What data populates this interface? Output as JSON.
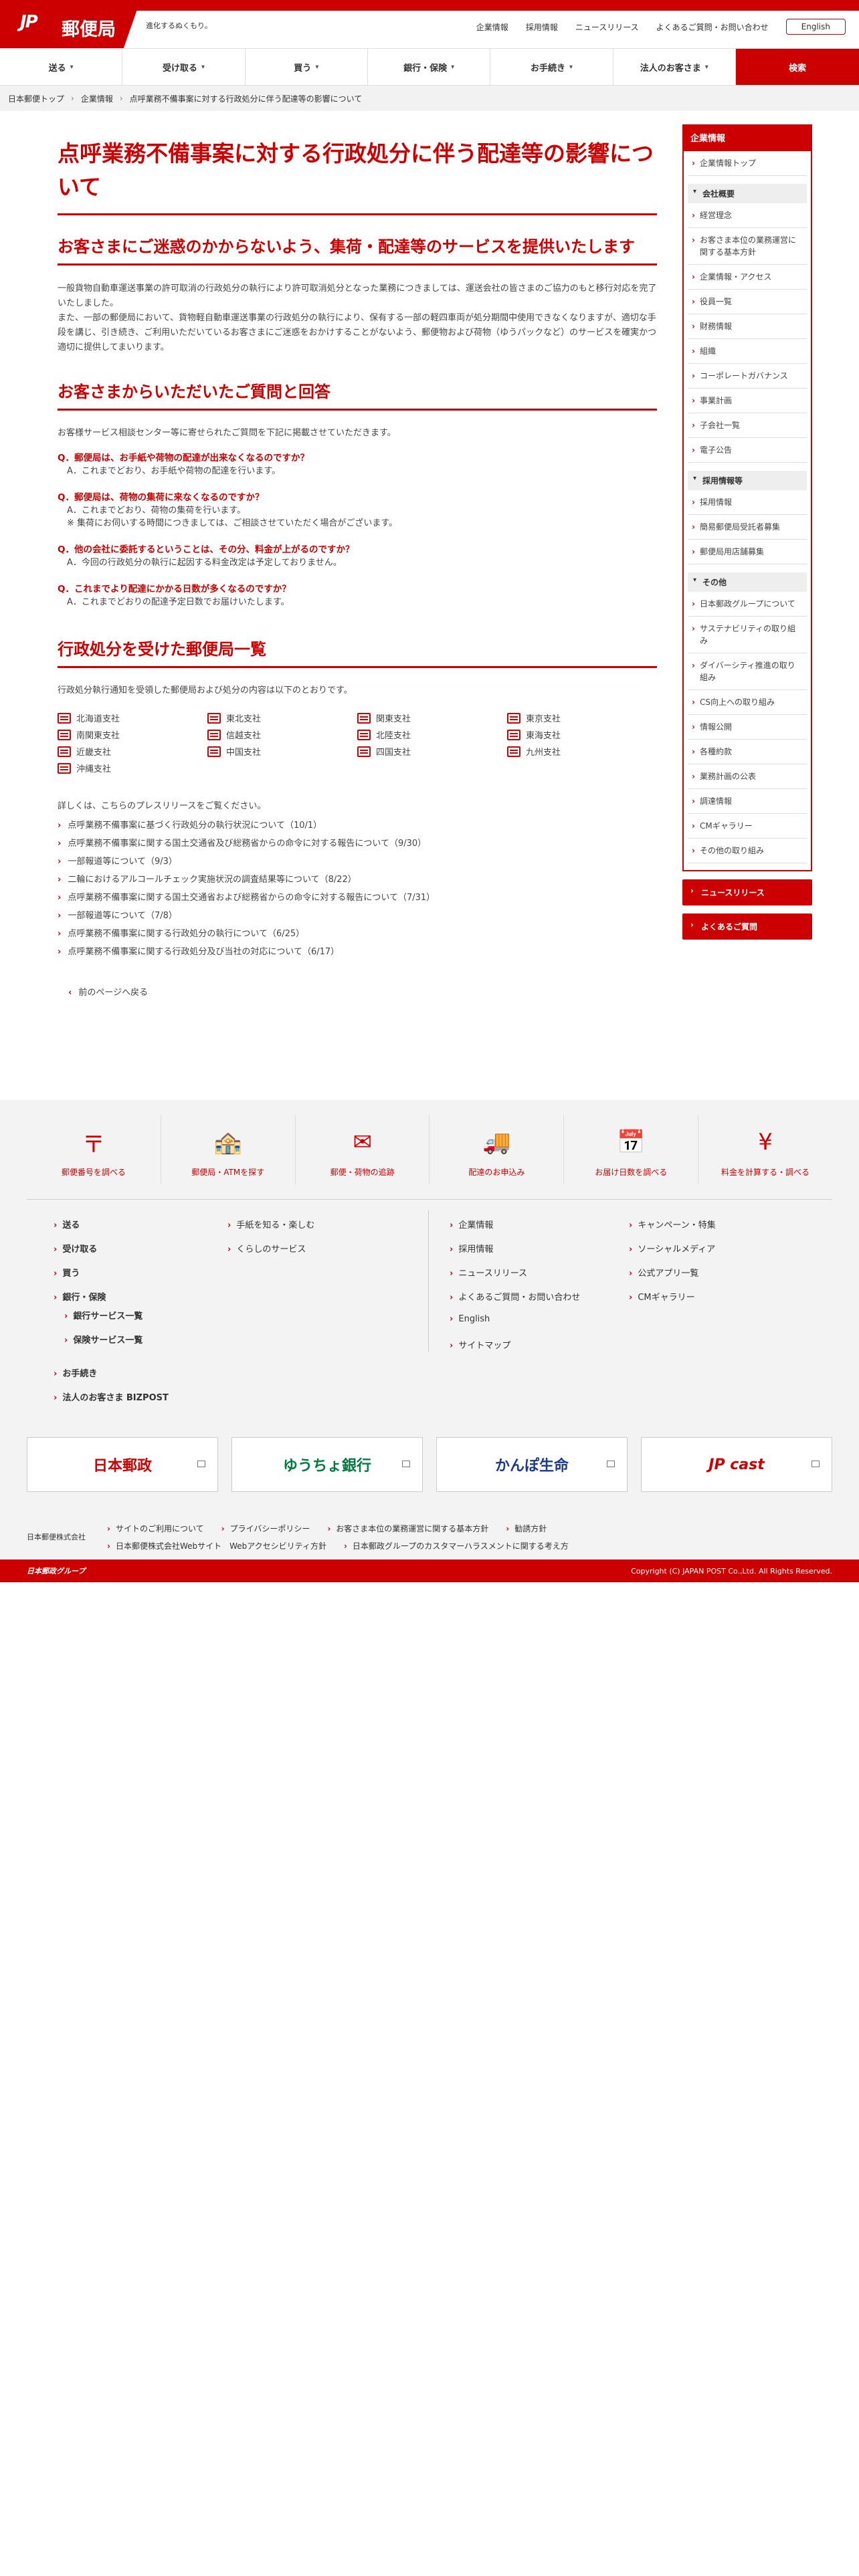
{
  "header": {
    "logo_mark": "JP",
    "logo_text": "郵便局",
    "tagline": "進化するぬくもり。",
    "links": [
      "企業情報",
      "採用情報",
      "ニュースリリース",
      "よくあるご質問・お問い合わせ"
    ],
    "english": "English"
  },
  "nav": {
    "items": [
      "送る",
      "受け取る",
      "買う",
      "銀行・保険",
      "お手続き",
      "法人のお客さま"
    ],
    "search": "検索"
  },
  "breadcrumb": [
    "日本郵便トップ",
    "企業情報",
    "点呼業務不備事案に対する行政処分に伴う配達等の影響について"
  ],
  "main": {
    "title": "点呼業務不備事案に対する行政処分に伴う配達等の影響について",
    "subtitle": "お客さまにご迷惑のかからないよう、集荷・配達等のサービスを提供いたします",
    "body": "一般貨物自動車運送事業の許可取消の行政処分の執行により許可取消処分となった業務につきましては、運送会社の皆さまのご協力のもと移行対応を完了いたしました。\nまた、一部の郵便局において、貨物軽自動車運送事業の行政処分の執行により、保有する一部の軽四車両が処分期間中使用できなくなりますが、適切な手段を講じ、引き続き、ご利用いただいているお客さまにご迷惑をおかけすることがないよう、郵便物および荷物（ゆうパックなど）のサービスを確実かつ適切に提供してまいります。",
    "faq_heading": "お客さまからいただいたご質問と回答",
    "faq_intro": "お客様サービス相談センター等に寄せられたご質問を下記に掲載させていただきます。",
    "faq": [
      {
        "q": "Q．郵便局は、お手紙や荷物の配達が出来なくなるのですか？",
        "a": "A．これまでどおり、お手紙や荷物の配達を行います。",
        "note": ""
      },
      {
        "q": "Q．郵便局は、荷物の集荷に来なくなるのですか？",
        "a": "A．これまでどおり、荷物の集荷を行います。",
        "note": "※ 集荷にお伺いする時間につきましては、ご相談させていただく場合がございます。"
      },
      {
        "q": "Q．他の会社に委託するということは、その分、料金が上がるのですか？",
        "a": "A．今回の行政処分の執行に起因する料金改定は予定しておりません。",
        "note": ""
      },
      {
        "q": "Q．これまでより配達にかかる日数が多くなるのですか？",
        "a": "A．これまでどおりの配達予定日数でお届けいたします。",
        "note": ""
      }
    ],
    "office_heading": "行政処分を受けた郵便局一覧",
    "office_intro": "行政処分執行通知を受領した郵便局および処分の内容は以下のとおりです。",
    "offices": [
      "北海道支社",
      "東北支社",
      "関東支社",
      "東京支社",
      "南関東支社",
      "信越支社",
      "北陸支社",
      "東海支社",
      "近畿支社",
      "中国支社",
      "四国支社",
      "九州支社",
      "沖縄支社"
    ],
    "press_intro": "詳しくは、こちらのプレスリリースをご覧ください。",
    "press": [
      "点呼業務不備事案に基づく行政処分の執行状況について（10/1）",
      "点呼業務不備事案に関する国土交通省及び総務省からの命令に対する報告について（9/30）",
      "一部報道等について（9/3）",
      "二輪におけるアルコールチェック実施状況の調査結果等について（8/22）",
      "点呼業務不備事案に関する国土交通省および総務省からの命令に対する報告について（7/31）",
      "一部報道等について（7/8）",
      "点呼業務不備事案に関する行政処分の執行について（6/25）",
      "点呼業務不備事案に関する行政処分及び当社の対応について（6/17）"
    ],
    "back": "前のページへ戻る"
  },
  "sidebar": {
    "title": "企業情報",
    "top": "企業情報トップ",
    "groups": [
      {
        "label": "会社概要",
        "items": [
          "経営理念",
          "お客さま本位の業務運営に関する基本方針",
          "企業情報・アクセス",
          "役員一覧",
          "財務情報",
          "組織",
          "コーポレートガバナンス",
          "事業計画",
          "子会社一覧",
          "電子公告"
        ]
      },
      {
        "label": "採用情報等",
        "items": [
          "採用情報",
          "簡易郵便局受託者募集",
          "郵便局用店舗募集"
        ]
      },
      {
        "label": "その他",
        "items": [
          "日本郵政グループについて",
          "サステナビリティの取り組み",
          "ダイバーシティ推進の取り組み",
          "CS向上への取り組み",
          "情報公開",
          "各種約款",
          "業務計画の公表",
          "調達情報",
          "CMギャラリー",
          "その他の取り組み"
        ]
      }
    ],
    "buttons": [
      "ニュースリリース",
      "よくあるご質問"
    ]
  },
  "footer": {
    "services": [
      "郵便番号を調べる",
      "郵便局・ATMを探す",
      "郵便・荷物の追跡",
      "配達のお申込み",
      "お届け日数を調べる",
      "料金を計算する・調べる"
    ],
    "col1": [
      "送る",
      "受け取る",
      "買う",
      "銀行・保険"
    ],
    "col1_sub": [
      "銀行サービス一覧",
      "保険サービス一覧"
    ],
    "col1b": [
      "お手続き",
      "法人のお客さま BIZPOST"
    ],
    "col2": [
      "手紙を知る・楽しむ",
      "くらしのサービス"
    ],
    "col3": [
      "企業情報",
      "採用情報",
      "ニュースリリース",
      "よくあるご質問・お問い合わせ",
      "English",
      "サイトマップ"
    ],
    "col4": [
      "キャンペーン・特集",
      "ソーシャルメディア",
      "公式アプリ一覧",
      "CMギャラリー"
    ],
    "banners": [
      "日本郵政",
      "ゆうちょ銀行",
      "かんぽ生命",
      "JP cast"
    ],
    "corp": "日本郵便株式会社",
    "links1": [
      "サイトのご利用について",
      "プライバシーポリシー",
      "お客さま本位の業務運営に関する基本方針",
      "勧誘方針"
    ],
    "links2": [
      "日本郵便株式会社Webサイト　Webアクセシビリティ方針",
      "日本郵政グループのカスタマーハラスメントに関する考え方"
    ],
    "group": "日本郵政グループ",
    "copyright": "Copyright (C) JAPAN POST Co.,Ltd.  All Rights Reserved."
  },
  "colors": {
    "accent": "#cc0000",
    "bg_gray": "#f3f3f3"
  }
}
